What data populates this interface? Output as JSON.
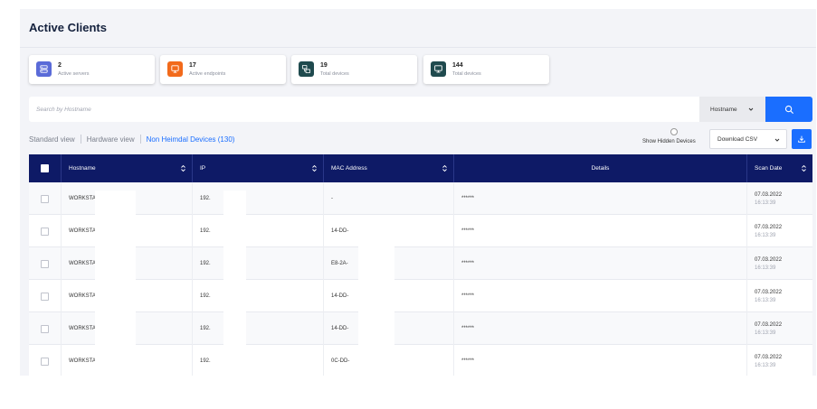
{
  "page": {
    "title": "Active Clients"
  },
  "cards": [
    {
      "value": "2",
      "label": "Active servers",
      "icon": "server-icon",
      "color": "#5a6bd8"
    },
    {
      "value": "17",
      "label": "Active endpoints",
      "icon": "monitor-icon",
      "color": "#f26a1b"
    },
    {
      "value": "19",
      "label": "Total devices",
      "icon": "devices-icon",
      "color": "#1f4a4e"
    },
    {
      "value": "144",
      "label": "Total devices",
      "icon": "desktop-icon",
      "color": "#1f4a4e"
    }
  ],
  "search": {
    "placeholder": "Search by Hostname",
    "field": "Hostname"
  },
  "views": {
    "standard": "Standard view",
    "hardware": "Hardware view",
    "non_heimdal": "Non Heimdal Devices (130)"
  },
  "toolbar": {
    "show_hidden": "Show Hidden Devices",
    "download": "Download CSV"
  },
  "table": {
    "headers": {
      "hostname": "Hostname",
      "ip": "IP",
      "mac": "MAC Address",
      "details": "Details",
      "scan_date": "Scan Date"
    },
    "rows": [
      {
        "hostname": "WORKSTA",
        "ip": "192.",
        "mac": "-",
        "details": "******",
        "date": "07.03.2022",
        "time": "16:13:39"
      },
      {
        "hostname": "WORKSTA",
        "ip": "192.",
        "mac": "14-DD-",
        "details": "******",
        "date": "07.03.2022",
        "time": "16:13:39"
      },
      {
        "hostname": "WORKSTA",
        "ip": "192.",
        "mac": "E8-2A-",
        "details": "******",
        "date": "07.03.2022",
        "time": "16:13:39"
      },
      {
        "hostname": "WORKSTA",
        "ip": "192.",
        "mac": "14-DD-",
        "details": "******",
        "date": "07.03.2022",
        "time": "16:13:39"
      },
      {
        "hostname": "WORKSTA",
        "ip": "192.",
        "mac": "14-DD-",
        "details": "******",
        "date": "07.03.2022",
        "time": "16:13:39"
      },
      {
        "hostname": "WORKSTA",
        "ip": "192.",
        "mac": "0C-DD-",
        "details": "******",
        "date": "07.03.2022",
        "time": "16:13:39"
      }
    ]
  },
  "colors": {
    "accent": "#1a6eff",
    "header_bg": "#0e1a66",
    "title": "#14213d"
  }
}
